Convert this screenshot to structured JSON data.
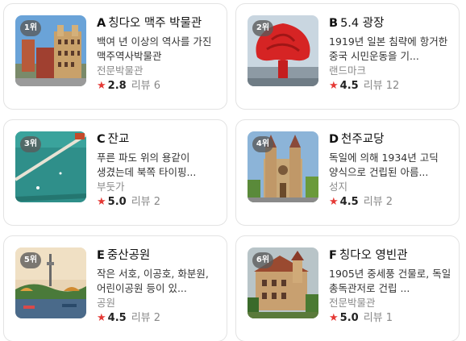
{
  "cards": [
    {
      "rank": "1위",
      "letter": "A",
      "name": "칭다오 맥주 박물관",
      "desc": "백여 년 이상의 역사를 가진 맥주역사박물관",
      "category": "전문박물관",
      "score": "2.8",
      "reviews": "리뷰 6",
      "image": "beer-museum"
    },
    {
      "rank": "2위",
      "letter": "B",
      "name": "5.4 광장",
      "desc": "1919년 일본 침략에 항거한 중국 시민운동을 기...",
      "category": "랜드마크",
      "score": "4.5",
      "reviews": "리뷰 12",
      "image": "may-fourth-square"
    },
    {
      "rank": "3위",
      "letter": "C",
      "name": "잔교",
      "desc": "푸른 파도 위의 용같이 생겼는데 북쪽 타이핑...",
      "category": "부둣가",
      "score": "5.0",
      "reviews": "리뷰 2",
      "image": "pier"
    },
    {
      "rank": "4위",
      "letter": "D",
      "name": "천주교당",
      "desc": "독일에 의해 1934년 고딕 양식으로 건립된 아름...",
      "category": "성지",
      "score": "4.5",
      "reviews": "리뷰 2",
      "image": "cathedral"
    },
    {
      "rank": "5위",
      "letter": "E",
      "name": "중산공원",
      "desc": "작은 서호, 이공호, 화분원, 어린이공원 등이 있...",
      "category": "공원",
      "score": "4.5",
      "reviews": "리뷰 2",
      "image": "park-tower"
    },
    {
      "rank": "6위",
      "letter": "F",
      "name": "칭다오 영빈관",
      "desc": "1905년 중세풍 건물로, 독일 총독관저로 건립 ...",
      "category": "전문박물관",
      "score": "5.0",
      "reviews": "리뷰 1",
      "image": "guesthouse"
    }
  ],
  "star_glyph": "★",
  "colors": {
    "star": "#e53935",
    "rank_badge": "#5a5a5a",
    "category": "#8a8a8a"
  }
}
